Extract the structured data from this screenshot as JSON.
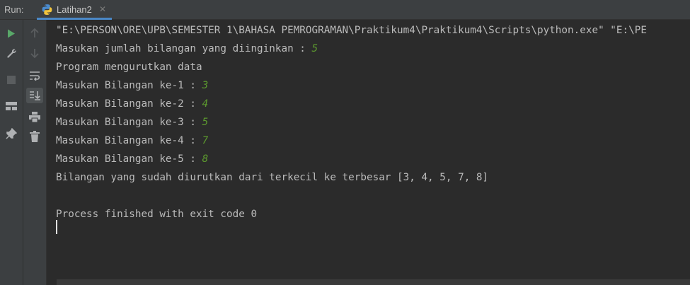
{
  "header": {
    "run_label": "Run:",
    "tab_title": "Latihan2",
    "tab_close": "✕"
  },
  "toolbar_left": [
    {
      "name": "rerun-icon",
      "color": "#59a869"
    },
    {
      "name": "wrench-icon"
    },
    {
      "name": "stop-icon"
    },
    {
      "name": "layout-icon"
    },
    {
      "name": "pin-icon"
    }
  ],
  "toolbar_right": [
    {
      "name": "scroll-up-icon"
    },
    {
      "name": "scroll-down-icon"
    },
    {
      "name": "soft-wrap-icon"
    },
    {
      "name": "scroll-to-end-icon"
    },
    {
      "name": "print-icon"
    },
    {
      "name": "trash-icon"
    }
  ],
  "console": {
    "command_line": "\"E:\\PERSON\\ORE\\UPB\\SEMESTER 1\\BAHASA PEMROGRAMAN\\Praktikum4\\Praktikum4\\Scripts\\python.exe\" \"E:\\PE",
    "prompt_count": "Masukan jumlah bilangan yang diinginkan : ",
    "input_count": "5",
    "program_title": "Program mengurutkan data",
    "prompts": [
      {
        "label": "Masukan Bilangan ke-1 : ",
        "value": "3"
      },
      {
        "label": "Masukan Bilangan ke-2 : ",
        "value": "4"
      },
      {
        "label": "Masukan Bilangan ke-3 : ",
        "value": "5"
      },
      {
        "label": "Masukan Bilangan ke-4 : ",
        "value": "7"
      },
      {
        "label": "Masukan Bilangan ke-5 : ",
        "value": "8"
      }
    ],
    "result": "Bilangan yang sudah diurutkan dari terkecil ke terbesar [3, 4, 5, 7, 8]",
    "exit_message": "Process finished with exit code 0"
  },
  "colors": {
    "input_green": "#5c9a2e",
    "tab_underline": "#4a88c7",
    "background": "#2b2b2b"
  }
}
